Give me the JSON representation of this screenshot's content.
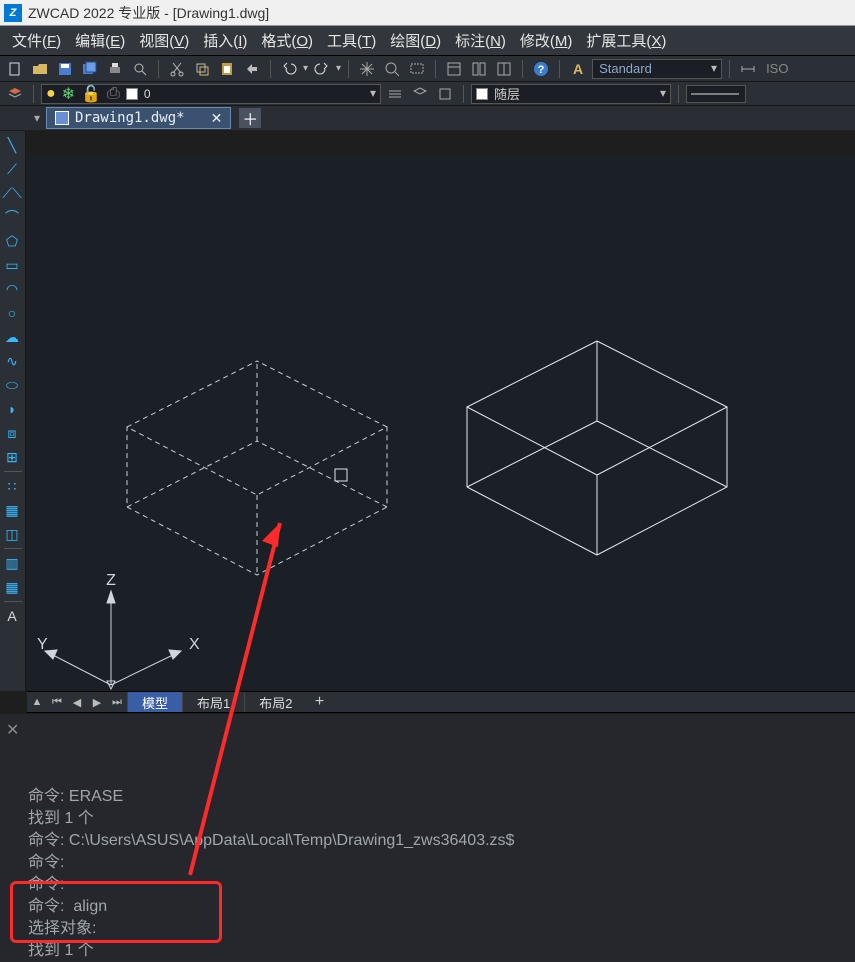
{
  "titlebar": {
    "app": "ZWCAD 2022 专业版",
    "doc": "[Drawing1.dwg]"
  },
  "menu": {
    "items": [
      {
        "label": "文件",
        "key": "F"
      },
      {
        "label": "编辑",
        "key": "E"
      },
      {
        "label": "视图",
        "key": "V"
      },
      {
        "label": "插入",
        "key": "I"
      },
      {
        "label": "格式",
        "key": "O"
      },
      {
        "label": "工具",
        "key": "T"
      },
      {
        "label": "绘图",
        "key": "D"
      },
      {
        "label": "标注",
        "key": "N"
      },
      {
        "label": "修改",
        "key": "M"
      },
      {
        "label": "扩展工具",
        "key": "X"
      }
    ]
  },
  "toolbar1": {
    "style_dd": "Standard",
    "iso": "ISO"
  },
  "toolbar2": {
    "layer_current": "0",
    "prop_dd": "随层"
  },
  "filetabs": {
    "current": "Drawing1.dwg*"
  },
  "layout_tabs": {
    "items": [
      "模型",
      "布局1",
      "布局2"
    ],
    "active": 0
  },
  "axes": {
    "x": "X",
    "y": "Y",
    "z": "Z"
  },
  "cmd": {
    "lines": [
      "命令: ERASE",
      "找到 1 个",
      "命令: C:\\Users\\ASUS\\AppData\\Local\\Temp\\Drawing1_zws36403.zs$",
      "命令:",
      "命令:",
      "命令:  align",
      "选择对象:",
      "找到 1 个"
    ]
  }
}
